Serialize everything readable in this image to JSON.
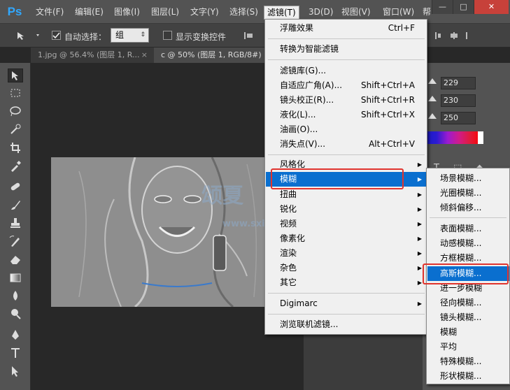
{
  "app": {
    "logo": "Ps"
  },
  "menubar": {
    "items": [
      "文件(F)",
      "编辑(E)",
      "图像(I)",
      "图层(L)",
      "文字(Y)",
      "选择(S)",
      "滤镜(T)",
      "3D(D)",
      "视图(V)",
      "窗口(W)",
      "帮"
    ],
    "active_index": 6,
    "window_buttons": [
      "—",
      "□",
      "✕"
    ]
  },
  "options": {
    "auto_select_label": "自动选择：",
    "auto_select_checked": true,
    "group_select_value": "组",
    "show_transform_label": "显示变换控件",
    "show_transform_checked": false
  },
  "tabs": [
    {
      "label": "1.jpg @ 56.4% (图层 1, R...",
      "close": "×"
    },
    {
      "label": "c @ 50% (图层 1, RGB/8#)",
      "close": "×"
    }
  ],
  "color_panel": {
    "r": "229",
    "g": "230",
    "b": "250"
  },
  "filter_menu": {
    "items": [
      {
        "label": "浮雕效果",
        "shortcut": "Ctrl+F"
      },
      {
        "label": "转换为智能滤镜"
      },
      {
        "label": "滤镜库(G)..."
      },
      {
        "label": "自适应广角(A)...",
        "shortcut": "Shift+Ctrl+A"
      },
      {
        "label": "镜头校正(R)...",
        "shortcut": "Shift+Ctrl+R"
      },
      {
        "label": "液化(L)...",
        "shortcut": "Shift+Ctrl+X"
      },
      {
        "label": "油画(O)..."
      },
      {
        "label": "消失点(V)...",
        "shortcut": "Alt+Ctrl+V"
      },
      {
        "label": "风格化"
      },
      {
        "label": "模糊",
        "highlighted": true
      },
      {
        "label": "扭曲"
      },
      {
        "label": "锐化"
      },
      {
        "label": "视频"
      },
      {
        "label": "像素化"
      },
      {
        "label": "渲染"
      },
      {
        "label": "杂色"
      },
      {
        "label": "其它"
      },
      {
        "label": "Digimarc"
      },
      {
        "label": "浏览联机滤镜..."
      }
    ]
  },
  "blur_submenu": {
    "items": [
      {
        "label": "场景模糊..."
      },
      {
        "label": "光圈模糊..."
      },
      {
        "label": "倾斜偏移..."
      },
      {
        "label": "表面模糊..."
      },
      {
        "label": "动感模糊..."
      },
      {
        "label": "方框模糊..."
      },
      {
        "label": "高斯模糊...",
        "highlighted": true
      },
      {
        "label": "进一步模糊"
      },
      {
        "label": "径向模糊..."
      },
      {
        "label": "镜头模糊..."
      },
      {
        "label": "模糊"
      },
      {
        "label": "平均"
      },
      {
        "label": "特殊模糊..."
      },
      {
        "label": "形状模糊..."
      }
    ]
  },
  "watermark": {
    "text_cn": "颂夏",
    "text_url": "www.sxia"
  },
  "colors": {
    "menu_highlight": "#0a6fcf",
    "annotation_red": "#e0342e",
    "ps_blue": "#31a8ff"
  }
}
